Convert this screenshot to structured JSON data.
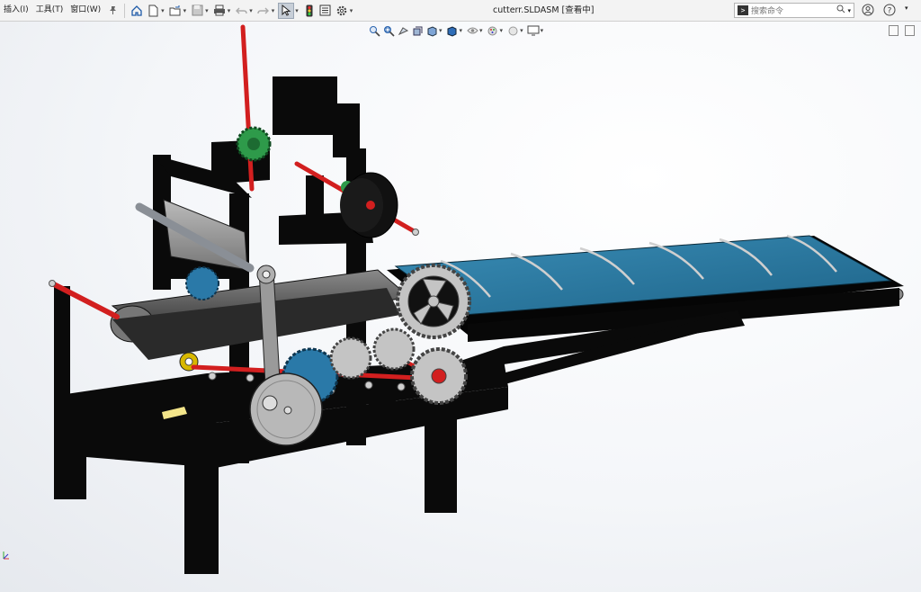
{
  "menu": {
    "items": [
      "插入(I)",
      "工具(T)",
      "窗口(W)"
    ]
  },
  "document": {
    "title": "cutterr.SLDASM [查看中]"
  },
  "search": {
    "placeholder": "搜索命令",
    "prompt_glyph": ">"
  },
  "toolbar": {
    "icons": [
      "pin-icon",
      "home-icon",
      "new-document-icon",
      "open-icon",
      "save-icon",
      "print-icon",
      "undo-icon",
      "redo-icon",
      "select-icon",
      "traffic-light-icon",
      "file-properties-icon",
      "options-gear-icon"
    ]
  },
  "view_toolbar": {
    "icons": [
      "zoom-to-fit-icon",
      "zoom-to-area-icon",
      "previous-view-icon",
      "section-view-icon",
      "view-orientation-icon",
      "display-style-icon",
      "hide-show-icon",
      "edit-appearance-icon",
      "apply-scene-icon",
      "view-settings-icon"
    ]
  },
  "colors": {
    "frame": "#0a0a0a",
    "belt": "#2f7fa6",
    "shaft": "#d21f1f",
    "gear_grey": "#c4c4c4",
    "gear_blue": "#2a79a8",
    "gear_green": "#2e9a4a",
    "roller_grey": "#6d6d6d"
  }
}
